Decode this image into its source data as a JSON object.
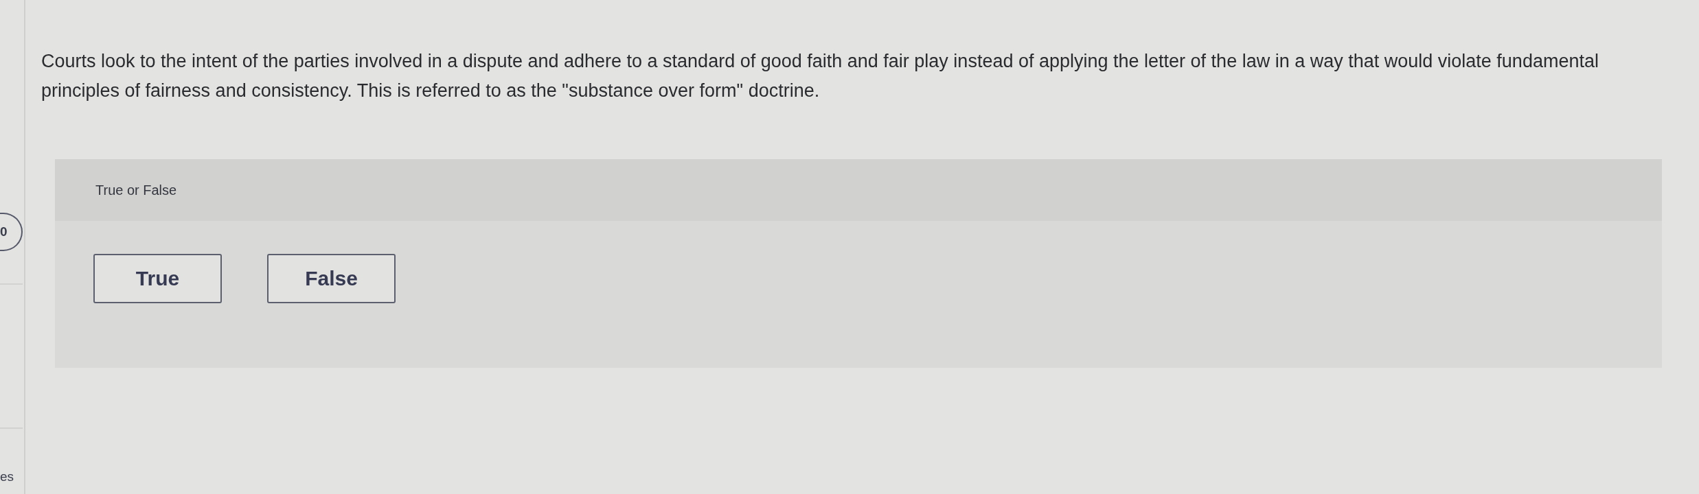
{
  "sidebar": {
    "badge": "0",
    "label": "es"
  },
  "question": {
    "prompt": "Courts look to the intent of the parties involved in a dispute and adhere to a standard of good faith and fair play instead of applying the letter of the law in a way that would violate fundamental principles of fairness and consistency. This is referred to as the \"substance over form\" doctrine.",
    "type_label": "True or False",
    "options": [
      {
        "label": "True",
        "selected": false
      },
      {
        "label": "False",
        "selected": false
      }
    ]
  }
}
